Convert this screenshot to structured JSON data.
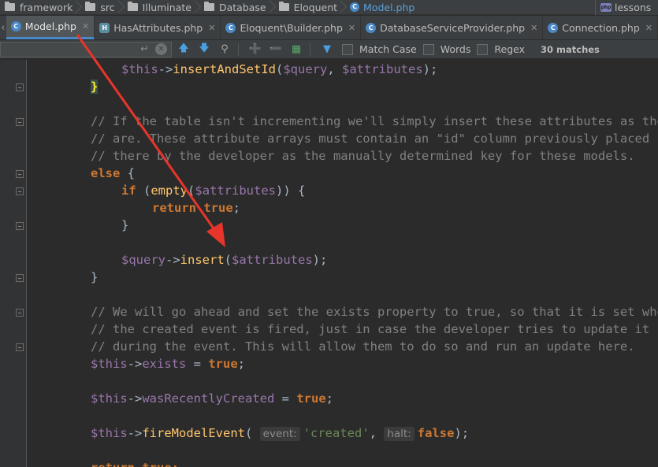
{
  "breadcrumb": {
    "items": [
      "framework",
      "src",
      "Illuminate",
      "Database",
      "Eloquent",
      "Model.php"
    ],
    "project": "lessons"
  },
  "tabs": [
    {
      "label": "Model.php",
      "icon": "class-icon",
      "active": true
    },
    {
      "label": "HasAttributes.php",
      "icon": "trait-icon",
      "active": false
    },
    {
      "label": "Eloquent\\Builder.php",
      "icon": "class-icon",
      "active": false
    },
    {
      "label": "DatabaseServiceProvider.php",
      "icon": "class-icon",
      "active": false
    },
    {
      "label": "Connection.php",
      "icon": "class-icon",
      "active": false
    }
  ],
  "find": {
    "value": "",
    "options": [
      {
        "label": "Match Case",
        "checked": false
      },
      {
        "label": "Words",
        "checked": false
      },
      {
        "label": "Regex",
        "checked": false
      }
    ],
    "matches": "30 matches"
  },
  "code": {
    "line_assign": "$this->insertAndSetId($query, $attributes);",
    "comment1": "// If the table isn't incrementing we'll simply insert these attributes as they",
    "comment2": "// are. These attribute arrays must contain an \"id\" column previously placed",
    "comment3": "// there by the developer as the manually determined key for these models.",
    "comment4": "// We will go ahead and set the exists property to true, so that it is set when",
    "comment5": "// the created event is fired, just in case the developer tries to update it",
    "comment6": "// during the event. This will allow them to do so and run an update here.",
    "hint_event": "event:",
    "hint_halt": "halt:",
    "return_partial": "return true;"
  },
  "colors": {
    "keyword": "#cc7832",
    "variable": "#9876aa",
    "function": "#ffc66d",
    "comment": "#808080",
    "string": "#6a8759",
    "annotation_arrow": "#e8352b"
  }
}
